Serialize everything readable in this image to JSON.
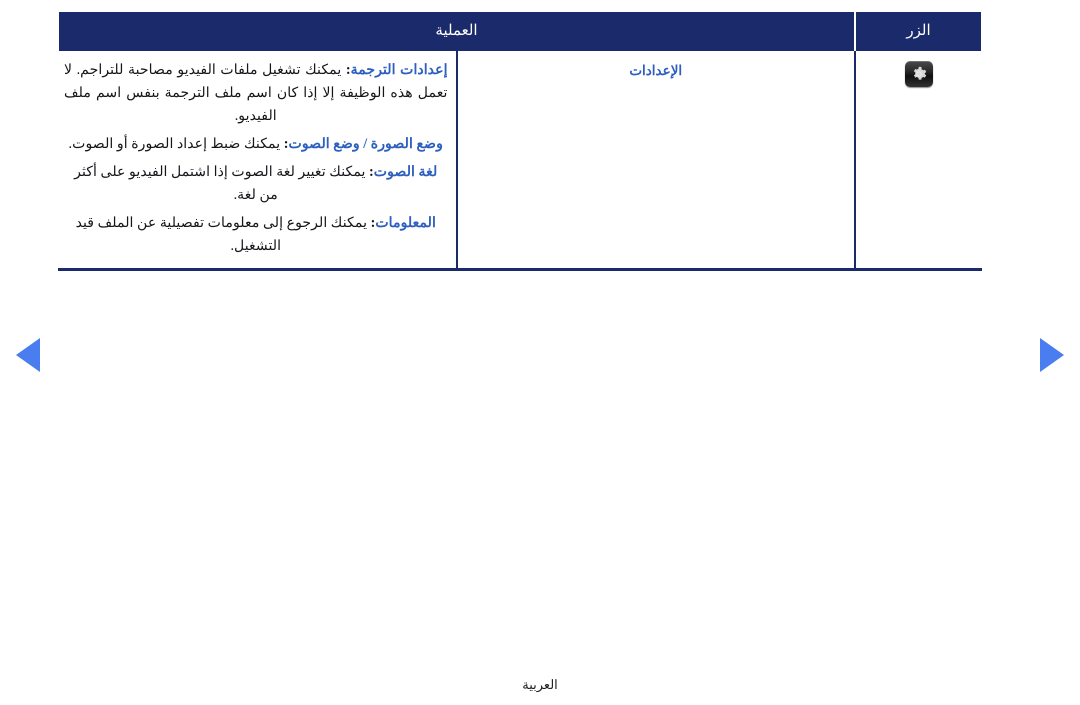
{
  "table": {
    "headers": {
      "button": "الزر",
      "operation": "العملية"
    },
    "row": {
      "icon_name": "gear-icon",
      "label": "الإعدادات",
      "items": [
        {
          "term": "إعدادات الترجمة",
          "separator": ":",
          "text": "يمكنك تشغيل ملفات الفيديو مصاحبة للتراجم. لا تعمل هذه الوظيفة إلا إذا كان اسم ملف الترجمة بنفس اسم ملف الفيديو."
        },
        {
          "term": "وضع الصورة / وضع الصوت",
          "separator": ":",
          "text": "يمكنك ضبط إعداد الصورة أو الصوت."
        },
        {
          "term": "لغة الصوت",
          "separator": ":",
          "text": "يمكنك تغيير لغة الصوت إذا اشتمل الفيديو على أكثر من لغة."
        },
        {
          "term": "المعلومات",
          "separator": ":",
          "text": "يمكنك الرجوع إلى معلومات تفصيلية عن الملف قيد التشغيل."
        }
      ]
    }
  },
  "navigation": {
    "prev_icon": "triangle-left-icon",
    "next_icon": "triangle-right-icon"
  },
  "footer": {
    "language": "العربية"
  },
  "colors": {
    "header_background": "#1b2a6b",
    "term_blue": "#2d5fc0",
    "arrow_blue": "#4a7df0",
    "body_text": "#15151a"
  }
}
